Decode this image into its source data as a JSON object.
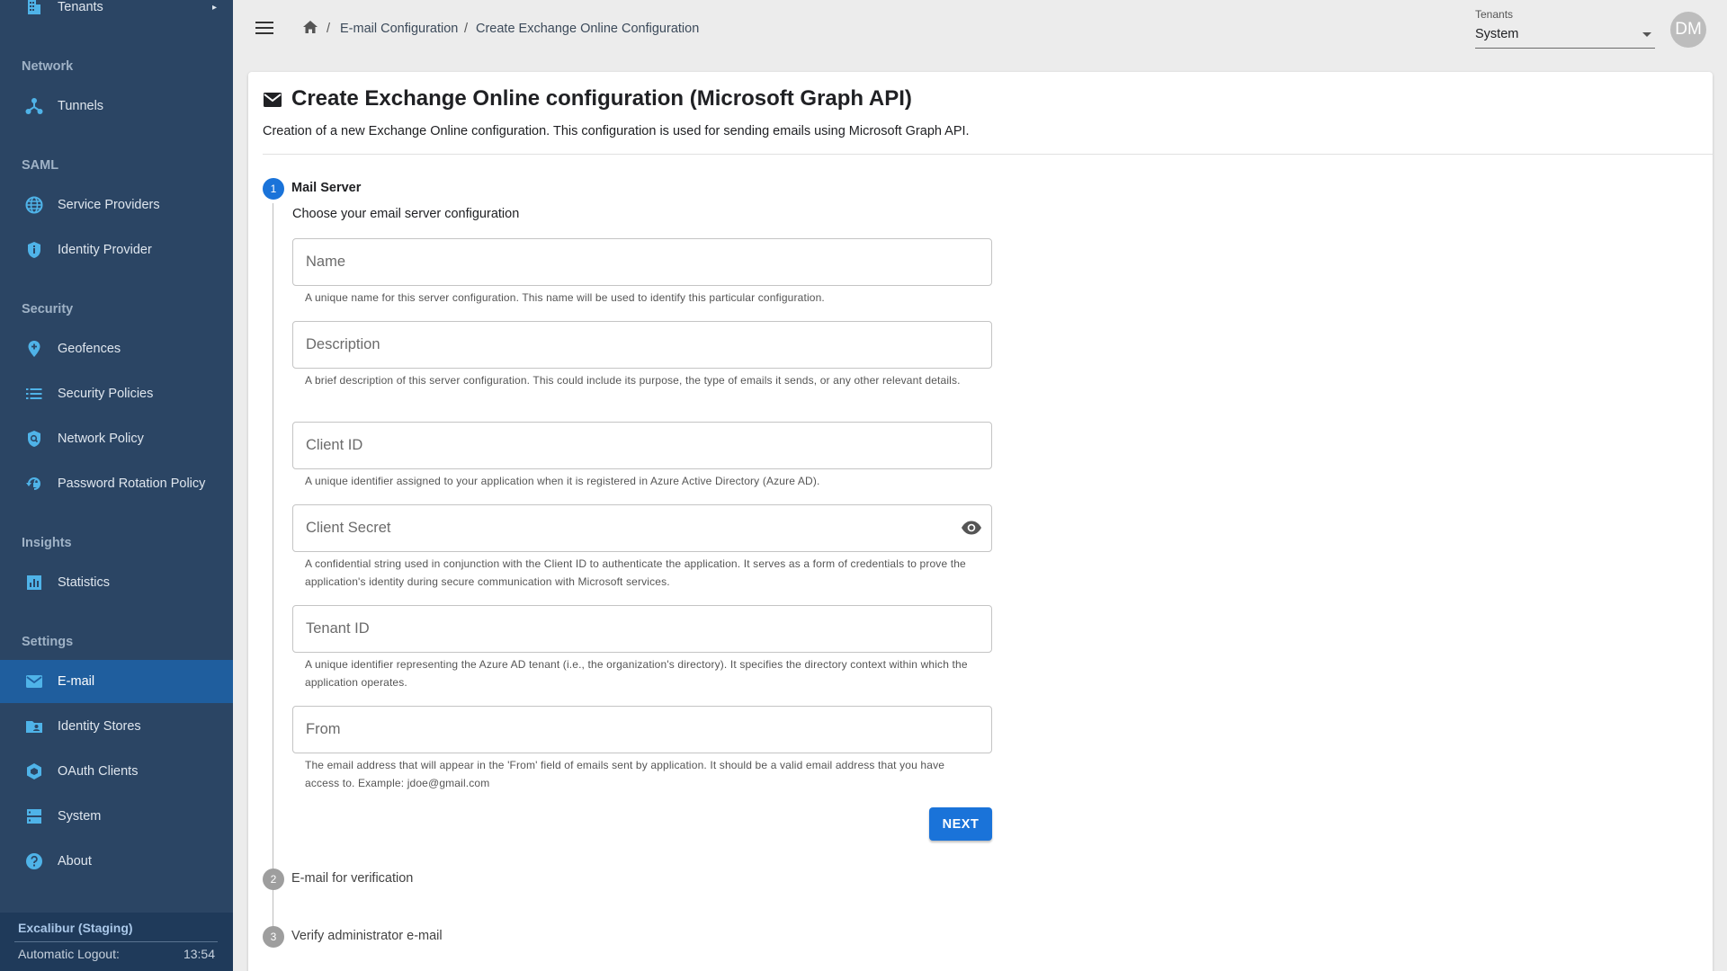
{
  "sidebar": {
    "items": [
      {
        "id": "tenants",
        "label": "Tenants"
      },
      {
        "id": "tunnels",
        "label": "Tunnels"
      },
      {
        "id": "service-providers",
        "label": "Service Providers"
      },
      {
        "id": "identity-provider",
        "label": "Identity Provider"
      },
      {
        "id": "geofences",
        "label": "Geofences"
      },
      {
        "id": "security-policies",
        "label": "Security Policies"
      },
      {
        "id": "network-policy",
        "label": "Network Policy"
      },
      {
        "id": "password-rotation-policy",
        "label": "Password Rotation Policy"
      },
      {
        "id": "statistics",
        "label": "Statistics"
      },
      {
        "id": "email",
        "label": "E-mail"
      },
      {
        "id": "identity-stores",
        "label": "Identity Stores"
      },
      {
        "id": "oauth-clients",
        "label": "OAuth Clients"
      },
      {
        "id": "system",
        "label": "System"
      },
      {
        "id": "about",
        "label": "About"
      }
    ],
    "sections": {
      "network": "Network",
      "saml": "SAML",
      "security": "Security",
      "insights": "Insights",
      "settings": "Settings"
    },
    "footer": {
      "title": "Excalibur (Staging)",
      "logout_label": "Automatic Logout:",
      "logout_time": "13:54"
    }
  },
  "breadcrumb": {
    "sep": "/",
    "items": [
      "E-mail Configuration",
      "Create Exchange Online Configuration"
    ]
  },
  "tenant_select": {
    "label": "Tenants",
    "value": "System"
  },
  "avatar": {
    "initials": "DM"
  },
  "page": {
    "title": "Create Exchange Online configuration (Microsoft Graph API)",
    "subtitle": "Creation of a new Exchange Online configuration. This configuration is used for sending emails using Microsoft Graph API."
  },
  "steps": [
    {
      "number": "1",
      "label": "Mail Server",
      "description": "Choose your email server configuration"
    },
    {
      "number": "2",
      "label": "E-mail for verification"
    },
    {
      "number": "3",
      "label": "Verify administrator e-mail"
    }
  ],
  "fields": {
    "name": {
      "placeholder": "Name",
      "value": "",
      "helper": "A unique name for this server configuration. This name will be used to identify this particular configuration."
    },
    "description": {
      "placeholder": "Description",
      "value": "",
      "helper": "A brief description of this server configuration. This could include its purpose, the type of emails it sends, or any other relevant details."
    },
    "client_id": {
      "placeholder": "Client ID",
      "value": "",
      "helper": "A unique identifier assigned to your application when it is registered in Azure Active Directory (Azure AD)."
    },
    "client_secret": {
      "placeholder": "Client Secret",
      "value": "",
      "helper": "A confidential string used in conjunction with the Client ID to authenticate the application. It serves as a form of credentials to prove the application's identity during secure communication with Microsoft services."
    },
    "tenant_id": {
      "placeholder": "Tenant ID",
      "value": "",
      "helper": "A unique identifier representing the Azure AD tenant (i.e., the organization's directory). It specifies the directory context within which the application operates."
    },
    "from": {
      "placeholder": "From",
      "value": "",
      "helper": "The email address that will appear in the 'From' field of emails sent by application. It should be a valid email address that you have access to. Example: jdoe@gmail.com"
    }
  },
  "actions": {
    "next_label": "NEXT"
  },
  "colors": {
    "sidebar_bg": "#2b4564",
    "sidebar_active": "#1f5e9e",
    "icon_accent": "#4fb3e8",
    "primary": "#1a73d9"
  }
}
